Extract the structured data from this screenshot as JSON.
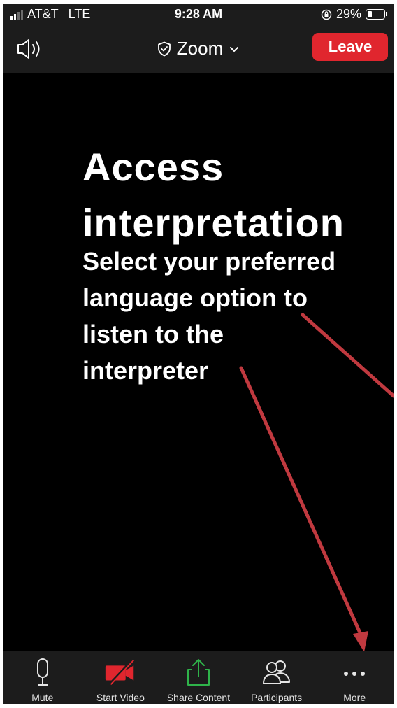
{
  "status_bar": {
    "carrier": "AT&T",
    "network": "LTE",
    "time": "9:28 AM",
    "battery_text": "29%",
    "battery_level": 0.29
  },
  "top_bar": {
    "speaker_icon": "speaker-icon",
    "title": "Zoom",
    "shield_icon": "shield-check-icon",
    "chevron_icon": "chevron-down-icon",
    "leave_label": "Leave",
    "leave_color": "#e0262e"
  },
  "main": {
    "heading_line1": "Access",
    "heading_line2": "interpretation",
    "sub_line1": "Select your preferred",
    "sub_line2": "language option to",
    "sub_line3": "listen to the",
    "sub_line4": "interpreter",
    "arrow_color": "#c0393f"
  },
  "toolbar": {
    "items": [
      {
        "label": "Mute",
        "icon": "microphone-icon"
      },
      {
        "label": "Start Video",
        "icon": "video-off-icon"
      },
      {
        "label": "Share Content",
        "icon": "share-icon"
      },
      {
        "label": "Participants",
        "icon": "participants-icon"
      },
      {
        "label": "More",
        "icon": "more-icon"
      }
    ],
    "video_off_color": "#e0262e",
    "share_color": "#2fb34a"
  }
}
